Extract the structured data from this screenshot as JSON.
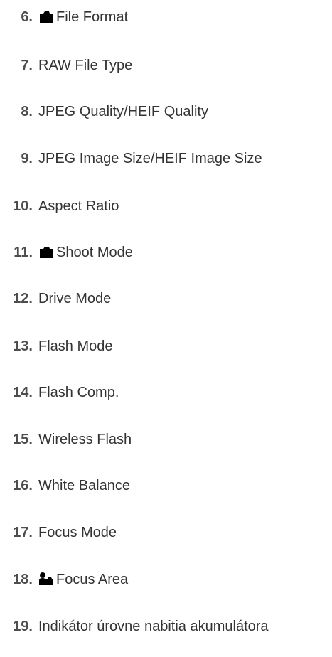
{
  "items": [
    {
      "num": "6.",
      "label": "File Format",
      "icon": "camera-icon"
    },
    {
      "num": "7.",
      "label": "RAW File Type"
    },
    {
      "num": "8.",
      "label": "JPEG Quality/HEIF Quality"
    },
    {
      "num": "9.",
      "label": "JPEG Image Size/HEIF Image Size"
    },
    {
      "num": "10.",
      "label": "Aspect Ratio"
    },
    {
      "num": "11.",
      "label": "Shoot Mode",
      "icon": "camera-icon"
    },
    {
      "num": "12.",
      "label": "Drive Mode"
    },
    {
      "num": "13.",
      "label": "Flash Mode"
    },
    {
      "num": "14.",
      "label": "Flash Comp."
    },
    {
      "num": "15.",
      "label": "Wireless Flash"
    },
    {
      "num": "16.",
      "label": "White Balance"
    },
    {
      "num": "17.",
      "label": "Focus Mode"
    },
    {
      "num": "18.",
      "label": "Focus Area",
      "icon": "camera-person-icon"
    },
    {
      "num": "19.",
      "label": "Indikátor úrovne nabitia akumulátora"
    }
  ]
}
